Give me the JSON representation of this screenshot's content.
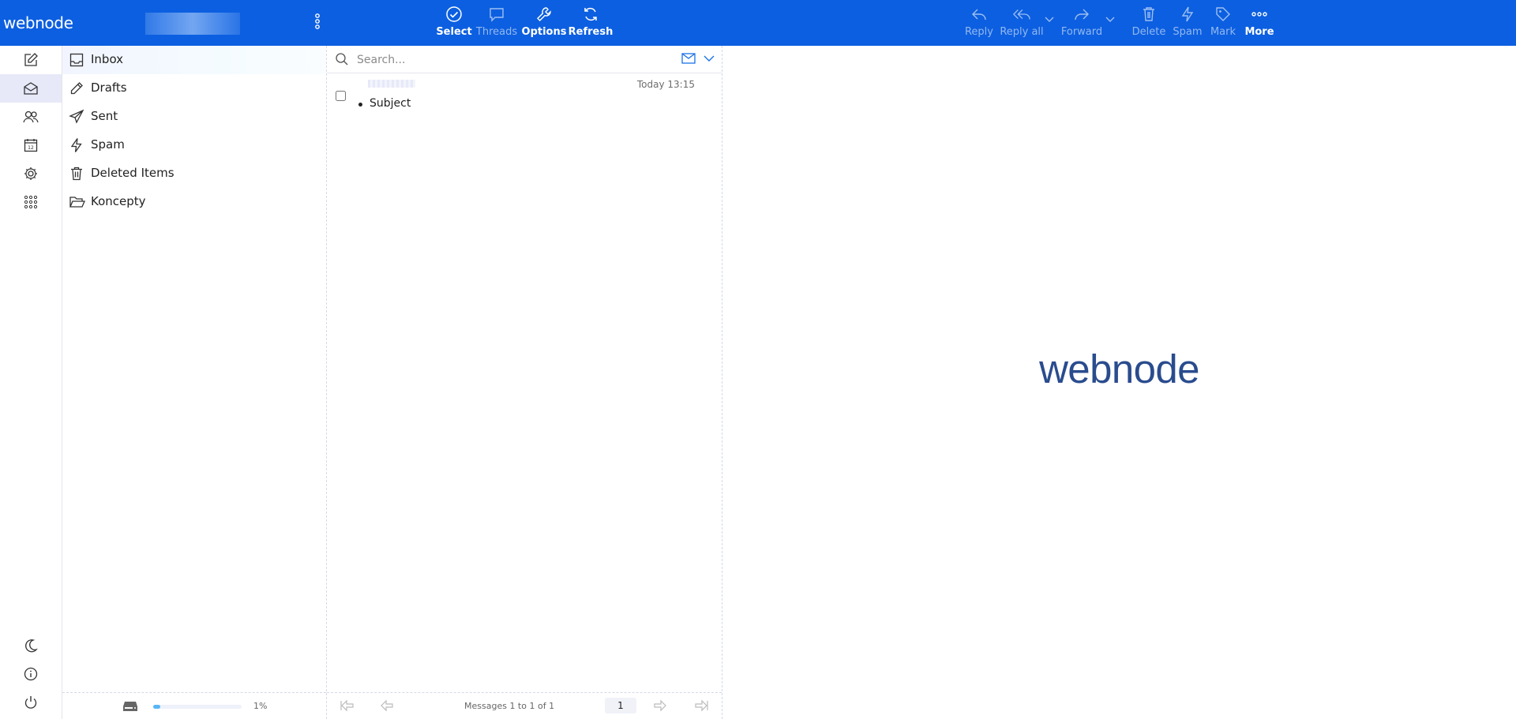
{
  "app": {
    "brand": "webnode"
  },
  "toolbar": {
    "select": "Select",
    "threads": "Threads",
    "options": "Options",
    "refresh": "Refresh",
    "reply": "Reply",
    "reply_all": "Reply all",
    "forward": "Forward",
    "delete": "Delete",
    "spam": "Spam",
    "mark": "Mark",
    "more": "More"
  },
  "folders": [
    {
      "name": "Inbox",
      "icon": "inbox-icon"
    },
    {
      "name": "Drafts",
      "icon": "pencil-icon"
    },
    {
      "name": "Sent",
      "icon": "paper-plane-icon"
    },
    {
      "name": "Spam",
      "icon": "lightning-icon"
    },
    {
      "name": "Deleted Items",
      "icon": "trash-icon"
    },
    {
      "name": "Koncepty",
      "icon": "folder-open-icon"
    }
  ],
  "quota": {
    "percent_label": "1%",
    "fraction": 0.01
  },
  "search": {
    "placeholder": "Search..."
  },
  "messages": [
    {
      "subject": "Subject",
      "date": "Today 13:15"
    }
  ],
  "pager": {
    "count_label": "Messages 1 to 1 of 1",
    "page": "1"
  },
  "preview": {
    "logo": "webnode"
  },
  "colors": {
    "topbar": "#0c5fe0",
    "accent": "#2a4c8e",
    "quota": "#58b6f6"
  }
}
